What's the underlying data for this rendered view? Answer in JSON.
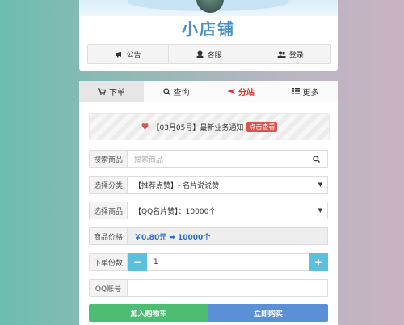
{
  "shop": {
    "title": "小店铺"
  },
  "top_nav": [
    {
      "label": "公告",
      "icon": "megaphone-icon"
    },
    {
      "label": "客服",
      "icon": "user-service-icon"
    },
    {
      "label": "登录",
      "icon": "users-icon"
    }
  ],
  "tabs": [
    {
      "label": "下单",
      "icon": "cart-icon",
      "active": true
    },
    {
      "label": "查询",
      "icon": "search-icon"
    },
    {
      "label": "分站",
      "icon": "arrow-icon",
      "highlight": true
    },
    {
      "label": "更多",
      "icon": "list-icon"
    }
  ],
  "notice": {
    "text": "【03月05号】最新业务通知",
    "badge": "点击查看"
  },
  "form": {
    "search": {
      "label": "搜索商品",
      "placeholder": "搜索商品"
    },
    "category": {
      "label": "选择分类",
      "value": "【推荐点赞】- 名片说说赞"
    },
    "product": {
      "label": "选择商品",
      "value": "【QQ名片赞】：10000个"
    },
    "price": {
      "label": "商品价格",
      "value": "￥0.80元 ➡ 10000个"
    },
    "quantity": {
      "label": "下单份数",
      "value": "1",
      "minus": "−",
      "plus": "+"
    },
    "qq": {
      "label": "QQ账号",
      "value": ""
    }
  },
  "buttons": {
    "cart": "加入购物车",
    "buy": "立即购买"
  },
  "colors": {
    "accent": "#4a8fc9",
    "hot": "#e0312a",
    "cart": "#4dbd74",
    "buy": "#5b8fd6",
    "stepper": "#5bc0de"
  }
}
